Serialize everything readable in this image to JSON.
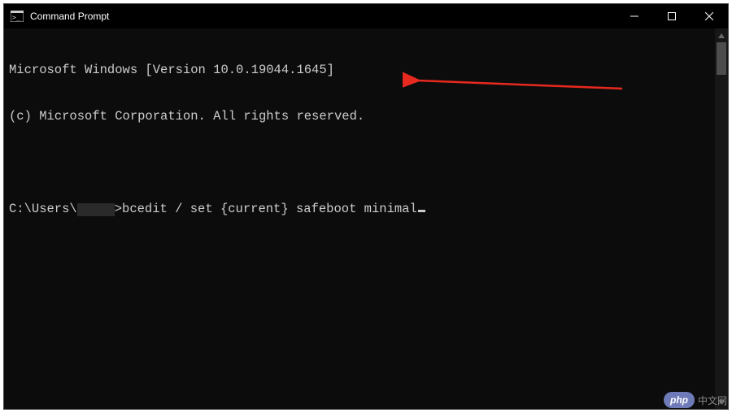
{
  "window": {
    "title": "Command Prompt"
  },
  "terminal": {
    "banner_line1": "Microsoft Windows [Version 10.0.19044.1645]",
    "banner_line2": "(c) Microsoft Corporation. All rights reserved.",
    "prompt_prefix": "C:\\Users\\",
    "prompt_suffix": ">",
    "command": "bcedit / set {current} safeboot minimal"
  },
  "watermark": {
    "badge": "php",
    "text": "中文网"
  }
}
